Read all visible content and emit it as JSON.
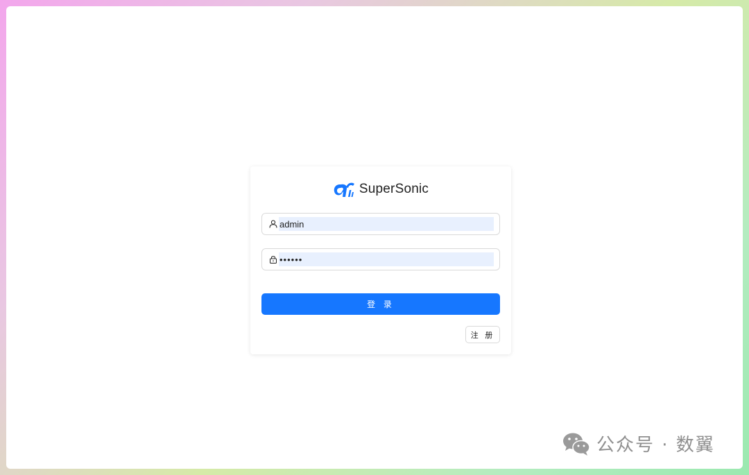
{
  "app": {
    "name": "SuperSonic"
  },
  "login_form": {
    "username_value": "admin",
    "password_value": "••••••",
    "login_label": "登 录",
    "register_label": "注 册"
  },
  "icons": {
    "logo": "supersonic-logo-icon",
    "username": "user-icon",
    "password": "lock-icon",
    "watermark": "wechat-icon"
  },
  "colors": {
    "primary": "#1677ff",
    "input_autofill_bg": "#e8f0fe",
    "border": "#d9d9d9"
  },
  "watermark": {
    "text": "公众号 · 数翼"
  }
}
